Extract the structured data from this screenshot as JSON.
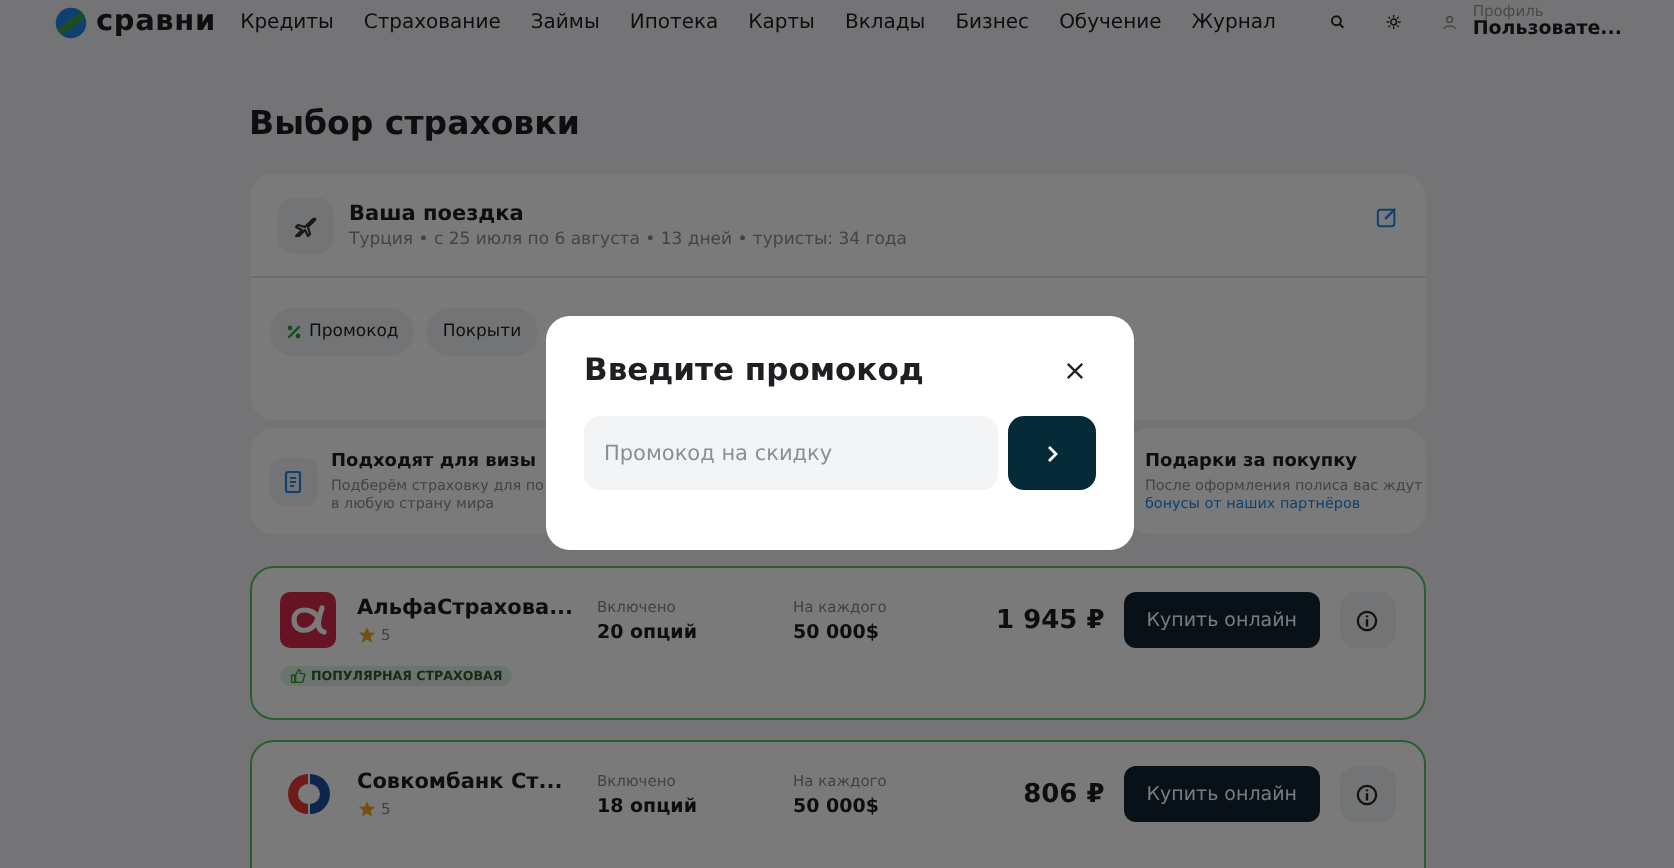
{
  "header": {
    "logo": "сравни",
    "nav": [
      "Кредиты",
      "Страхование",
      "Займы",
      "Ипотека",
      "Карты",
      "Вклады",
      "Бизнес",
      "Обучение",
      "Журнал"
    ],
    "profile_label": "Профиль",
    "profile_name": "Пользовате..."
  },
  "page_title": "Выбор страховки",
  "trip": {
    "title": "Ваша поездка",
    "details": "Турция • с 25 июля по 6 августа • 13 дней • туристы: 34 года",
    "chips": [
      {
        "label": "Промокод",
        "kind": "promo"
      },
      {
        "label": "Покрыти",
        "kind": "plain"
      }
    ]
  },
  "benefits": [
    {
      "kind": "visa",
      "title": "Подходят для визы",
      "text": "Подберём страховку для по",
      "text_2": "в любую страну мира"
    },
    {
      "kind": "gift",
      "title": "Подарки за покупку",
      "text": "После оформления полиса вас ждут",
      "link": "бонусы от наших партнёров"
    }
  ],
  "offers": [
    {
      "kind": "alfa",
      "name": "АльфаСтрахова...",
      "rating": "5",
      "included_label": "Включено",
      "included": "20 опций",
      "each_label": "На каждого",
      "each": "50 000$",
      "price": "1 945 ₽",
      "button": "Купить онлайн",
      "badge": "ПОПУЛЯРНАЯ СТРАХОВАЯ"
    },
    {
      "kind": "sovcom",
      "name": "Совкомбанк Ст...",
      "rating": "5",
      "included_label": "Включено",
      "included": "18 опций",
      "each_label": "На каждого",
      "each": "50 000$",
      "price": "806 ₽",
      "button": "Купить онлайн"
    }
  ],
  "modal": {
    "title": "Введите промокод",
    "placeholder": "Промокод на скидку"
  }
}
